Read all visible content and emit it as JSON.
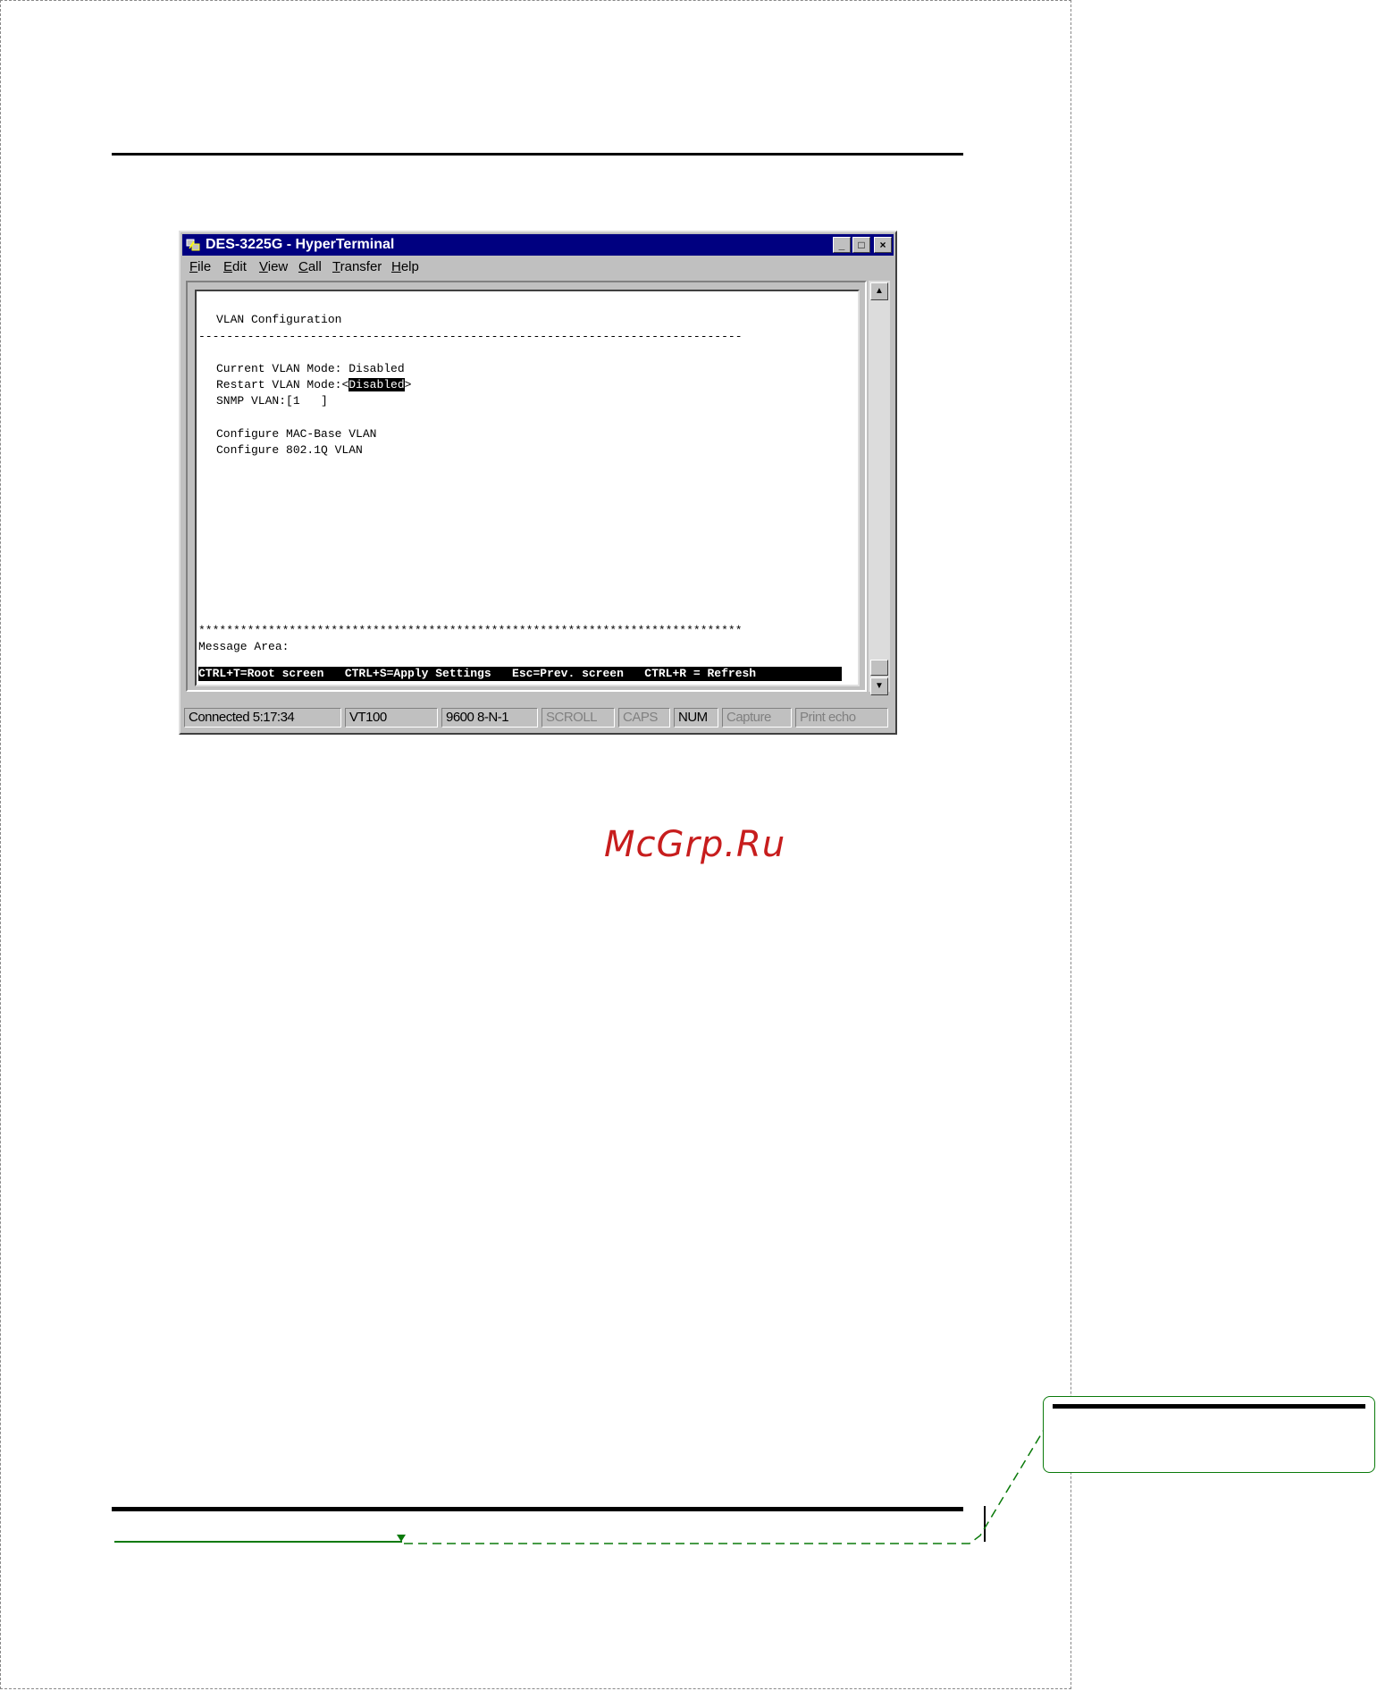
{
  "window": {
    "title": "DES-3225G - HyperTerminal",
    "controls": {
      "minimize": "_",
      "maximize": "□",
      "close": "×"
    }
  },
  "menubar": [
    "File",
    "Edit",
    "View",
    "Call",
    "Transfer",
    "Help"
  ],
  "terminal": {
    "heading": "VLAN Configuration",
    "divider": "------------------------------------------------------------------------------",
    "current_mode_label": "Current VLAN Mode: ",
    "current_mode_value": "Disabled",
    "restart_mode_label": "Restart VLAN Mode:",
    "restart_open": "<",
    "restart_mode_value": "Disabled",
    "restart_close": ">",
    "snmp_vlan_label": "SNMP VLAN:",
    "snmp_vlan_value": "[1   ]",
    "link_mac": "Configure MAC-Base VLAN",
    "link_8021q": "Configure 802.1Q VLAN",
    "stars": "******************************************************************************",
    "message_area": "Message Area:",
    "hotkeys": "CTRL+T=Root screen   CTRL+S=Apply Settings   Esc=Prev. screen   CTRL+R = Refresh"
  },
  "scrollbar": {
    "up": "▲",
    "down": "▼"
  },
  "statusbar": {
    "connected": "Connected 5:17:34",
    "emulation": "VT100",
    "port_settings": "9600 8-N-1",
    "scroll": "SCROLL",
    "caps": "CAPS",
    "num": "NUM",
    "capture": "Capture",
    "print_echo": "Print echo"
  },
  "watermark": "McGrp.Ru",
  "colors": {
    "titlebar": "#000080",
    "window": "#c0c0c0",
    "watermark": "#c71d1d",
    "leader": "#0a7a0a"
  }
}
